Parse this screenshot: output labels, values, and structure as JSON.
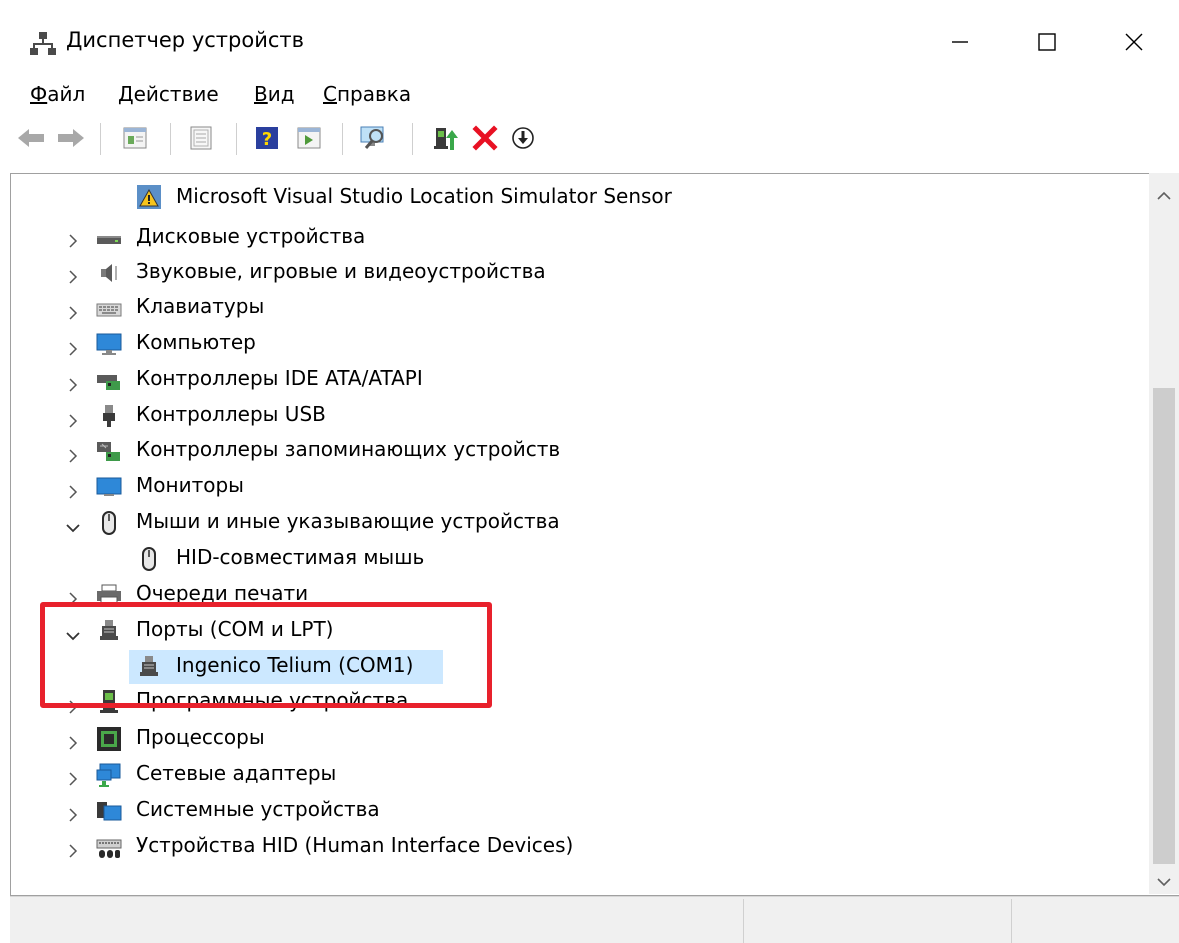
{
  "window": {
    "title": "Диспетчер устройств"
  },
  "menu": {
    "file": {
      "hotkey": "Ф",
      "rest": "айл"
    },
    "action": {
      "hotkey": "Д",
      "rest": "ействие"
    },
    "view": {
      "hotkey": "В",
      "rest": "ид"
    },
    "help": {
      "hotkey": "С",
      "rest": "правка"
    }
  },
  "toolbar": {
    "icons": [
      "back-arrow-icon",
      "forward-arrow-icon",
      "properties-icon",
      "show-hidden-icon",
      "help-icon",
      "run-icon",
      "scan-hardware-icon",
      "update-driver-icon",
      "uninstall-icon",
      "disable-icon"
    ]
  },
  "tree": {
    "rows": [
      {
        "label": "Microsoft Visual Studio Location Simulator Sensor",
        "icon": "sensor-warning-icon"
      },
      {
        "label": "Дисковые устройства",
        "icon": "disk-drive-icon"
      },
      {
        "label": "Звуковые, игровые и видеоустройства",
        "icon": "speaker-icon"
      },
      {
        "label": "Клавиатуры",
        "icon": "keyboard-icon"
      },
      {
        "label": "Компьютер",
        "icon": "computer-icon"
      },
      {
        "label": "Контроллеры IDE ATA/ATAPI",
        "icon": "ide-controller-icon"
      },
      {
        "label": "Контроллеры USB",
        "icon": "usb-icon"
      },
      {
        "label": "Контроллеры запоминающих устройств",
        "icon": "storage-controller-icon"
      },
      {
        "label": "Мониторы",
        "icon": "monitor-icon"
      },
      {
        "label": "Мыши и иные указывающие устройства",
        "icon": "mouse-icon"
      },
      {
        "label": "HID-совместимая мышь",
        "icon": "mouse-icon"
      },
      {
        "label": "Очереди печати",
        "icon": "printer-icon"
      },
      {
        "label": "Порты (COM и LPT)",
        "icon": "port-icon"
      },
      {
        "label": "Ingenico Telium (COM1)",
        "icon": "port-icon"
      },
      {
        "label": "Программные устройства",
        "icon": "software-device-icon"
      },
      {
        "label": "Процессоры",
        "icon": "processor-icon"
      },
      {
        "label": "Сетевые адаптеры",
        "icon": "network-adapter-icon"
      },
      {
        "label": "Системные устройства",
        "icon": "system-device-icon"
      },
      {
        "label": "Устройства HID (Human Interface Devices)",
        "icon": "hid-device-icon"
      }
    ]
  },
  "colors": {
    "selection": "#cce8ff",
    "highlight_box": "#e8212c",
    "uninstall_x": "#e81123"
  }
}
